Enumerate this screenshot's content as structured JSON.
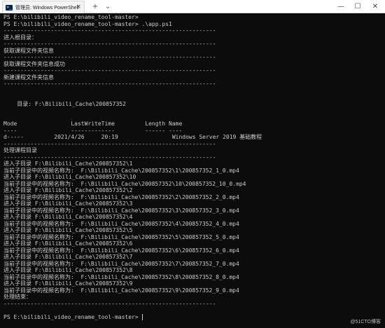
{
  "window": {
    "tab_icon": "powershell-icon",
    "tab_title": "管理员: Windows PowerShell",
    "tab_close": "×",
    "new_tab": "+",
    "dropdown": "⌄",
    "minimize": "—",
    "maximize": "☐",
    "close": "✕"
  },
  "console": {
    "lines": [
      "PS E:\\bilibili_video_rename_tool-master>",
      "PS E:\\bilibili_video_rename_tool-master> .\\app.ps1",
      "---------------------------------------------------------------",
      "进入根目录：",
      "---------------------------------------------------------------",
      "获取课程文件夹信息",
      "---------------------------------------------------------------",
      "获取课程文件夹信息成功",
      "---------------------------------------------------------------",
      "新建课程文件夹信息",
      "---------------------------------------------------------------",
      "",
      "",
      "    目录: F:\\Bilibili_Cache\\200857352",
      "",
      "",
      "Mode                LastWriteTime         Length Name",
      "----                -------------         ------ ----",
      "d-----         2021/4/26     20:19                Windows Server 2019 基础教程",
      "---------------------------------------------------------------",
      "处理课程目录",
      "---------------------------------------------------------------",
      "进入子目录 F:\\Bilibili_Cache\\200857352\\1",
      "当前子目录中的视频名称为:  F:\\Bilibili_Cache\\200857352\\1\\200857352_1_0.mp4",
      "进入子目录 F:\\Bilibili_Cache\\200857352\\10",
      "当前子目录中的视频名称为:  F:\\Bilibili_Cache\\200857352\\10\\200857352_10_0.mp4",
      "进入子目录 F:\\Bilibili_Cache\\200857352\\2",
      "当前子目录中的视频名称为:  F:\\Bilibili_Cache\\200857352\\2\\200857352_2_0.mp4",
      "进入子目录 F:\\Bilibili_Cache\\200857352\\3",
      "当前子目录中的视频名称为:  F:\\Bilibili_Cache\\200857352\\3\\200857352_3_0.mp4",
      "进入子目录 F:\\Bilibili_Cache\\200857352\\4",
      "当前子目录中的视频名称为:  F:\\Bilibili_Cache\\200857352\\4\\200857352_4_0.mp4",
      "进入子目录 F:\\Bilibili_Cache\\200857352\\5",
      "当前子目录中的视频名称为:  F:\\Bilibili_Cache\\200857352\\5\\200857352_5_0.mp4",
      "进入子目录 F:\\Bilibili_Cache\\200857352\\6",
      "当前子目录中的视频名称为:  F:\\Bilibili_Cache\\200857352\\6\\200857352_6_0.mp4",
      "进入子目录 F:\\Bilibili_Cache\\200857352\\7",
      "当前子目录中的视频名称为:  F:\\Bilibili_Cache\\200857352\\7\\200857352_7_0.mp4",
      "进入子目录 F:\\Bilibili_Cache\\200857352\\8",
      "当前子目录中的视频名称为:  F:\\Bilibili_Cache\\200857352\\8\\200857352_8_0.mp4",
      "进入子目录 F:\\Bilibili_Cache\\200857352\\9",
      "当前子目录中的视频名称为:  F:\\Bilibili_Cache\\200857352\\9\\200857352_9_0.mp4",
      "处理结束：",
      "---------------------------------------------------------------",
      "",
      "PS E:\\bilibili_video_rename_tool-master>"
    ]
  },
  "watermark": "@51CTO博客",
  "colors": {
    "background": "#0c0c0c",
    "text": "#cccccc",
    "titlebar": "#ffffff"
  }
}
